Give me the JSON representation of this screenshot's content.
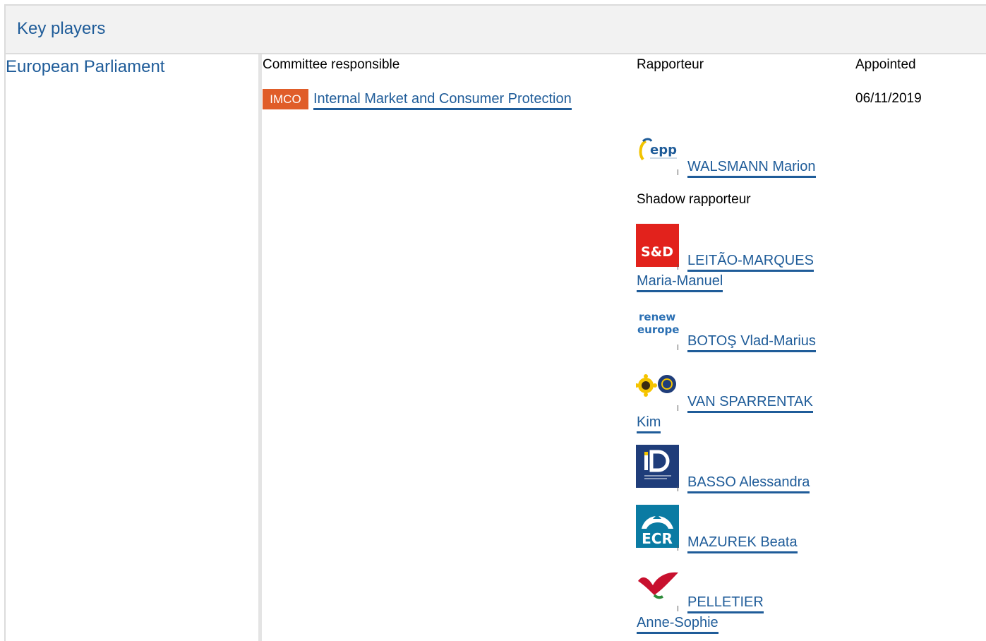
{
  "header": {
    "title": "Key players"
  },
  "institution": {
    "label": "European Parliament"
  },
  "columns": {
    "committee": "Committee responsible",
    "rapporteur": "Rapporteur",
    "appointed": "Appointed"
  },
  "committee": {
    "badge": "IMCO",
    "badge_color": "#e05d29",
    "name": "Internal Market and Consumer Protection",
    "appointed": "06/11/2019"
  },
  "rapporteur": {
    "group_logo": "epp-logo",
    "group_logo_text": "epp",
    "name": "WALSMANN Marion"
  },
  "shadow": {
    "label": "Shadow rapporteur",
    "items": [
      {
        "logo": "sd-logo",
        "logo_text": "S&D",
        "name_line1": "LEITÃO-MARQUES",
        "name_line2": "Maria-Manuel"
      },
      {
        "logo": "renew-europe-logo",
        "logo_text": "renew europe.",
        "name_line1": "BOTOŞ Vlad-Marius"
      },
      {
        "logo": "greens-efa-logo",
        "name_line1": "VAN SPARRENTAK",
        "name_line2": "Kim"
      },
      {
        "logo": "id-logo",
        "logo_text": "ID",
        "name_line1": "BASSO Alessandra"
      },
      {
        "logo": "ecr-logo",
        "logo_text": "ECR",
        "name_line1": "MAZUREK Beata"
      },
      {
        "logo": "gue-ngl-logo",
        "name_line1": "PELLETIER",
        "name_line2": "Anne-Sophie"
      }
    ]
  },
  "colors": {
    "link": "#1f5c99",
    "header_bg": "#f2f2f2",
    "sd_red": "#e2221c",
    "id_blue": "#1f3d7a",
    "ecr_teal": "#0a7ba3"
  }
}
